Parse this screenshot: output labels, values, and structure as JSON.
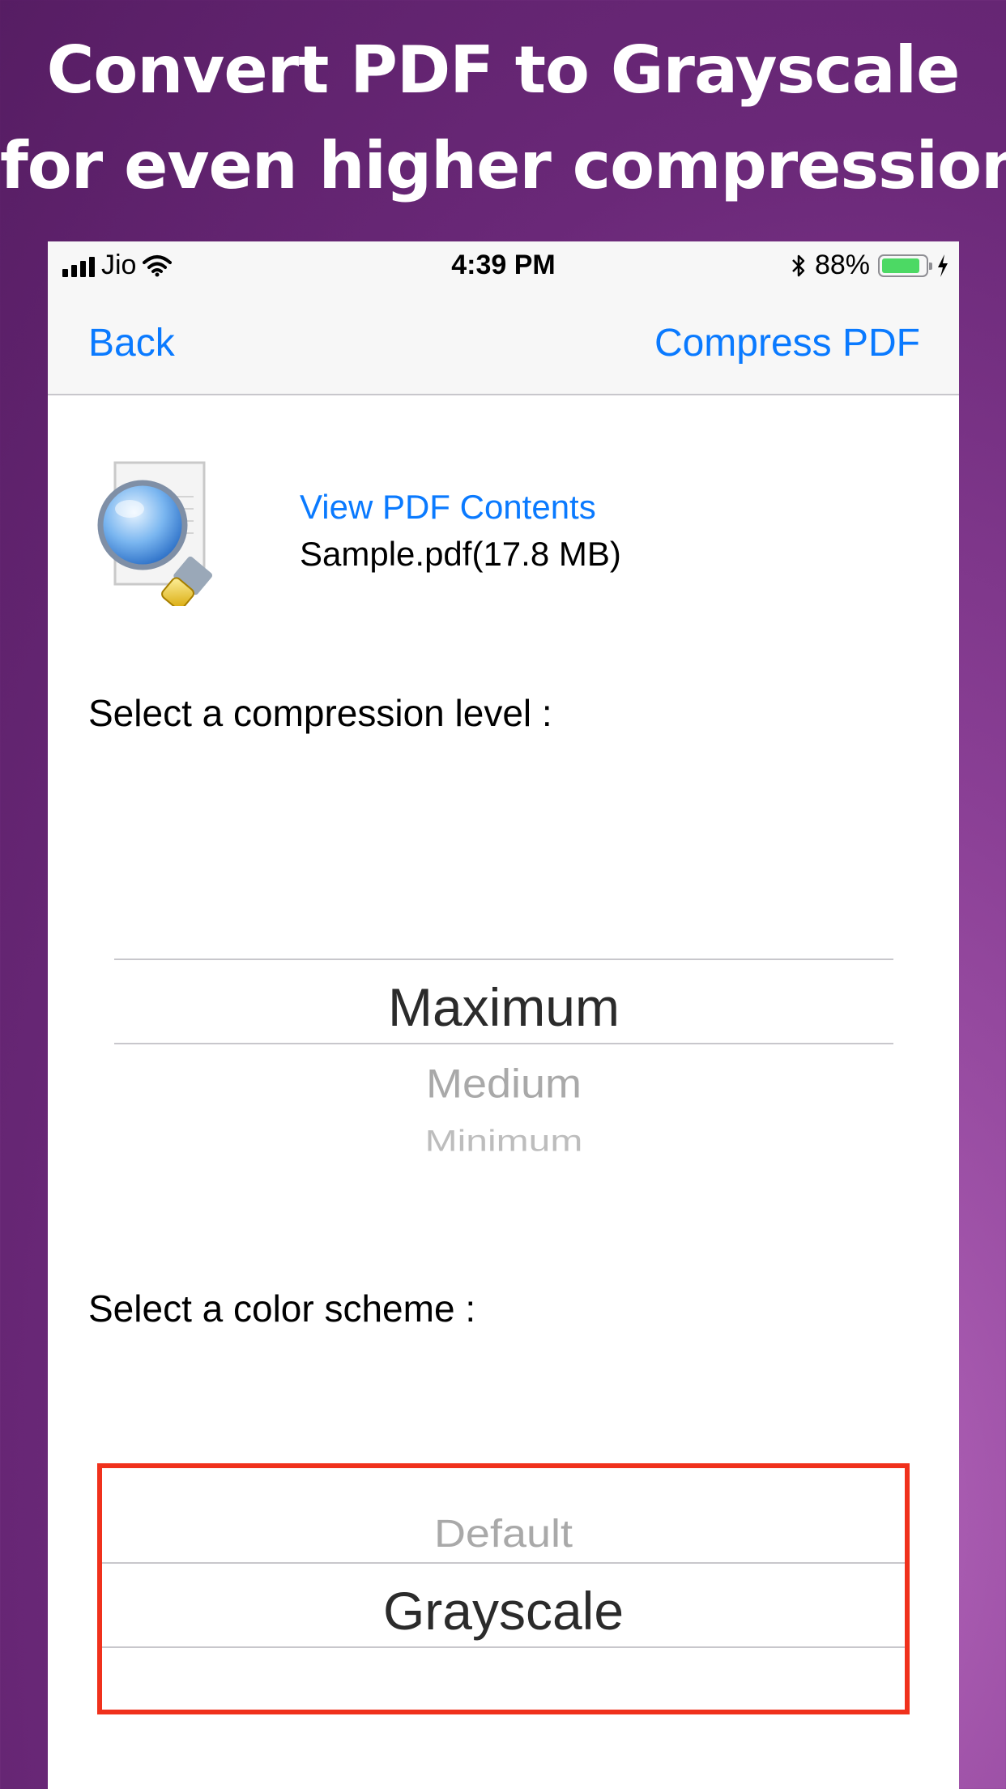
{
  "headline": {
    "line1": "Convert PDF to Grayscale",
    "line2": "for even higher compression"
  },
  "status_bar": {
    "carrier": "Jio",
    "time": "4:39 PM",
    "battery_percent": "88%",
    "battery_level": 0.88,
    "battery_color": "#4cd964"
  },
  "nav": {
    "back_label": "Back",
    "action_label": "Compress PDF",
    "tint_color": "#0a7aff"
  },
  "file": {
    "view_link": "View PDF Contents",
    "name": "Sample.pdf(17.8 MB)",
    "icon": "document-magnifier-icon"
  },
  "compression": {
    "label": "Select a compression level :",
    "options": [
      "Maximum",
      "Medium",
      "Minimum"
    ],
    "selected": "Maximum"
  },
  "color_scheme": {
    "label": "Select a color scheme :",
    "options": [
      "Default",
      "Grayscale"
    ],
    "selected": "Grayscale",
    "highlight_color": "#f0311c"
  }
}
